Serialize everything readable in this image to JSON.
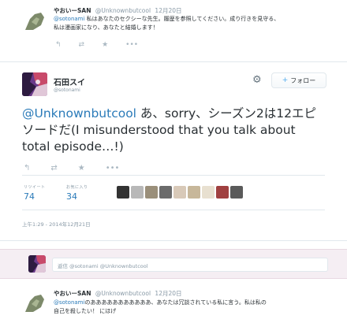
{
  "tweet1": {
    "name": "やおいーSAN",
    "handle": "@Unknownbutcool",
    "time": "12月20日",
    "mention": "@sotonami",
    "line1": " 私はあなたのセクシーな先生。履歴を参照してください。成り行きを見守る、",
    "line2": "私は漫画家になり、あなたと結婚します！"
  },
  "main": {
    "name": "石田スイ",
    "handle": "@sotonami",
    "follow_label": "フォロー",
    "mention": "@Unknownbutcool",
    "text": " あ、sorry、シーズン2は12エピソードだ(I misunderstood that you talk about total episode…!)",
    "retweets_label": "リツイート",
    "retweets": "74",
    "favorites_label": "お気に入り",
    "favorites": "34",
    "timestamp": "上午1:29 - 2014年12月21日"
  },
  "reply": {
    "placeholder": "返信 @sotonami @Unknownbutcool"
  },
  "tweet2": {
    "name": "やおいーSAN",
    "handle": "@Unknownbutcool",
    "time": "12月20日",
    "mention": "@sotonami",
    "line1": "のあああああああああああ、あなたは冗談されている私に言う。私は私の",
    "line2": "自己を殺したい！ にほげ"
  },
  "colors": {
    "link": "#2b7bb9",
    "reply_bg": "#f5eef3",
    "follow_icon": "#55acee"
  },
  "icons": [
    "reply-icon",
    "retweet-icon",
    "favorite-icon",
    "more-icon",
    "gear-icon",
    "follow-person-icon"
  ]
}
